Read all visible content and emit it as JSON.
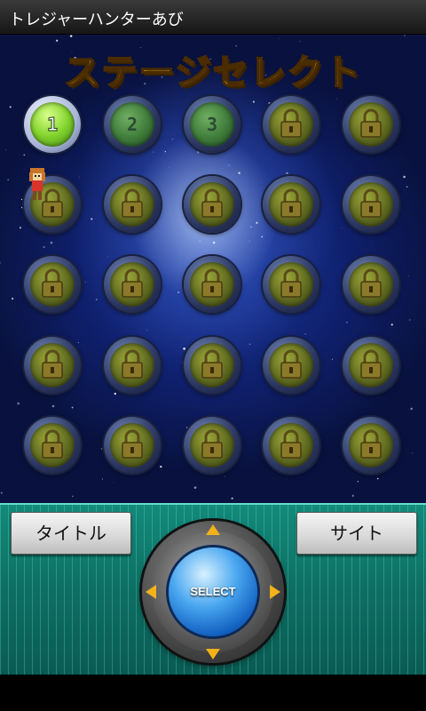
{
  "app": {
    "title": "トレジャーハンターあび"
  },
  "header": {
    "title": "ステージセレクト"
  },
  "stages": [
    {
      "label": "1",
      "state": "current"
    },
    {
      "label": "2",
      "state": "unlocked"
    },
    {
      "label": "3",
      "state": "unlocked"
    },
    {
      "label": "",
      "state": "locked"
    },
    {
      "label": "",
      "state": "locked"
    },
    {
      "label": "",
      "state": "locked"
    },
    {
      "label": "",
      "state": "locked"
    },
    {
      "label": "",
      "state": "locked"
    },
    {
      "label": "",
      "state": "locked"
    },
    {
      "label": "",
      "state": "locked"
    },
    {
      "label": "",
      "state": "locked"
    },
    {
      "label": "",
      "state": "locked"
    },
    {
      "label": "",
      "state": "locked"
    },
    {
      "label": "",
      "state": "locked"
    },
    {
      "label": "",
      "state": "locked"
    },
    {
      "label": "",
      "state": "locked"
    },
    {
      "label": "",
      "state": "locked"
    },
    {
      "label": "",
      "state": "locked"
    },
    {
      "label": "",
      "state": "locked"
    },
    {
      "label": "",
      "state": "locked"
    },
    {
      "label": "",
      "state": "locked"
    },
    {
      "label": "",
      "state": "locked"
    },
    {
      "label": "",
      "state": "locked"
    },
    {
      "label": "",
      "state": "locked"
    },
    {
      "label": "",
      "state": "locked"
    }
  ],
  "controls": {
    "title_button": "タイトル",
    "site_button": "サイト",
    "select_button": "SELECT"
  },
  "colors": {
    "accent": "#f3b21a",
    "panel": "#0e6e63",
    "header_text": "#ffd84a"
  }
}
